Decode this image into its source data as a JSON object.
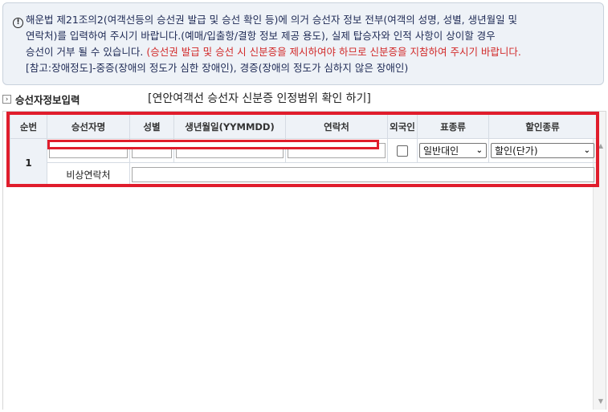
{
  "notice": {
    "icon": "exclamation-circle-icon",
    "line1": "해운법 제21조의2(여객선등의 승선권 발급 및 승선 확인 등)에 의거 승선자 정보 전부(여객의 성명, 성별, 생년월일 및",
    "line2": "연락처)를 입력하여 주시기 바랍니다.(예매/입출항/결항 정보 제공 용도), 실제 탑승자와 인적 사항이 상이할 경우",
    "line3_normal": "승선이 거부 될 수 있습니다. ",
    "line3_red": "(승선권 발급 및 승선 시 신분증을 제시하여야 하므로 신분증을 지참하여 주시기 바랍니다.",
    "line4": "[참고:장애정도]-중증(장애의 정도가 심한 장애인), 경증(장애의 정도가 심하지 않은 장애인)"
  },
  "section": {
    "title": "승선자정보입력",
    "link": "[연안여객선 승선자 신분증 인정범위 확인 하기]"
  },
  "table": {
    "headers": [
      "순번",
      "승선자명",
      "성별",
      "생년월일(YYMMDD)",
      "연락처",
      "외국인",
      "표종류",
      "할인종류"
    ],
    "rows": [
      {
        "num": "1",
        "name": "",
        "gender": "",
        "birth": "",
        "phone": "",
        "foreigner": false,
        "ticket_type": "일반대인",
        "discount_type": "할인(단가)",
        "emergency_label": "비상연락처",
        "emergency_value": ""
      }
    ]
  },
  "colors": {
    "highlight": "#e01d2c",
    "notice_bg": "#eef2f7",
    "notice_text": "#1e2a55",
    "notice_red": "#d22a2a"
  }
}
